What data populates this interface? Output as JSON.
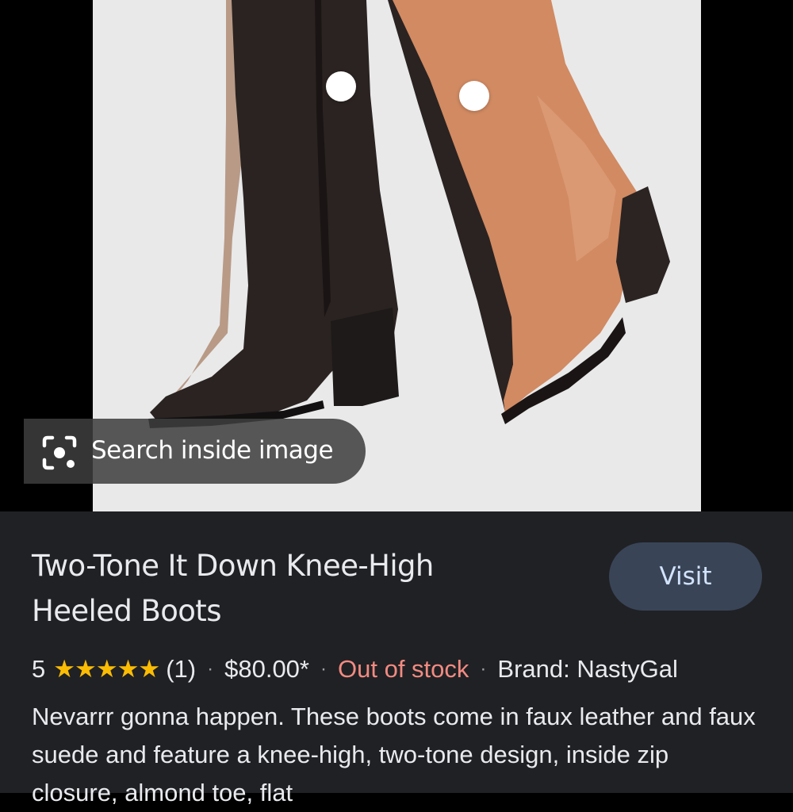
{
  "lens": {
    "label": "Search inside image"
  },
  "product": {
    "title_line1": "Two-Tone It Down Knee-High",
    "title_line2": "Heeled Boots",
    "visit_label": "Visit",
    "rating": "5",
    "rating_stars": 5,
    "stars_glyph": "★★★★★",
    "review_count": "(1)",
    "separator": "·",
    "price": "$80.00*",
    "stock_status": "Out of stock",
    "brand": "Brand: NastyGal",
    "description": "Nevarrr gonna happen. These boots come in faux leather and faux suede and feature a knee-high, two-tone design, inside zip closure, almond toe, flat"
  },
  "colors": {
    "panel_bg": "#202124",
    "visit_bg": "#394457",
    "visit_text": "#d3e3fd",
    "star": "#fbbc04",
    "out_of_stock": "#f28b82",
    "text": "#e8eaed"
  }
}
